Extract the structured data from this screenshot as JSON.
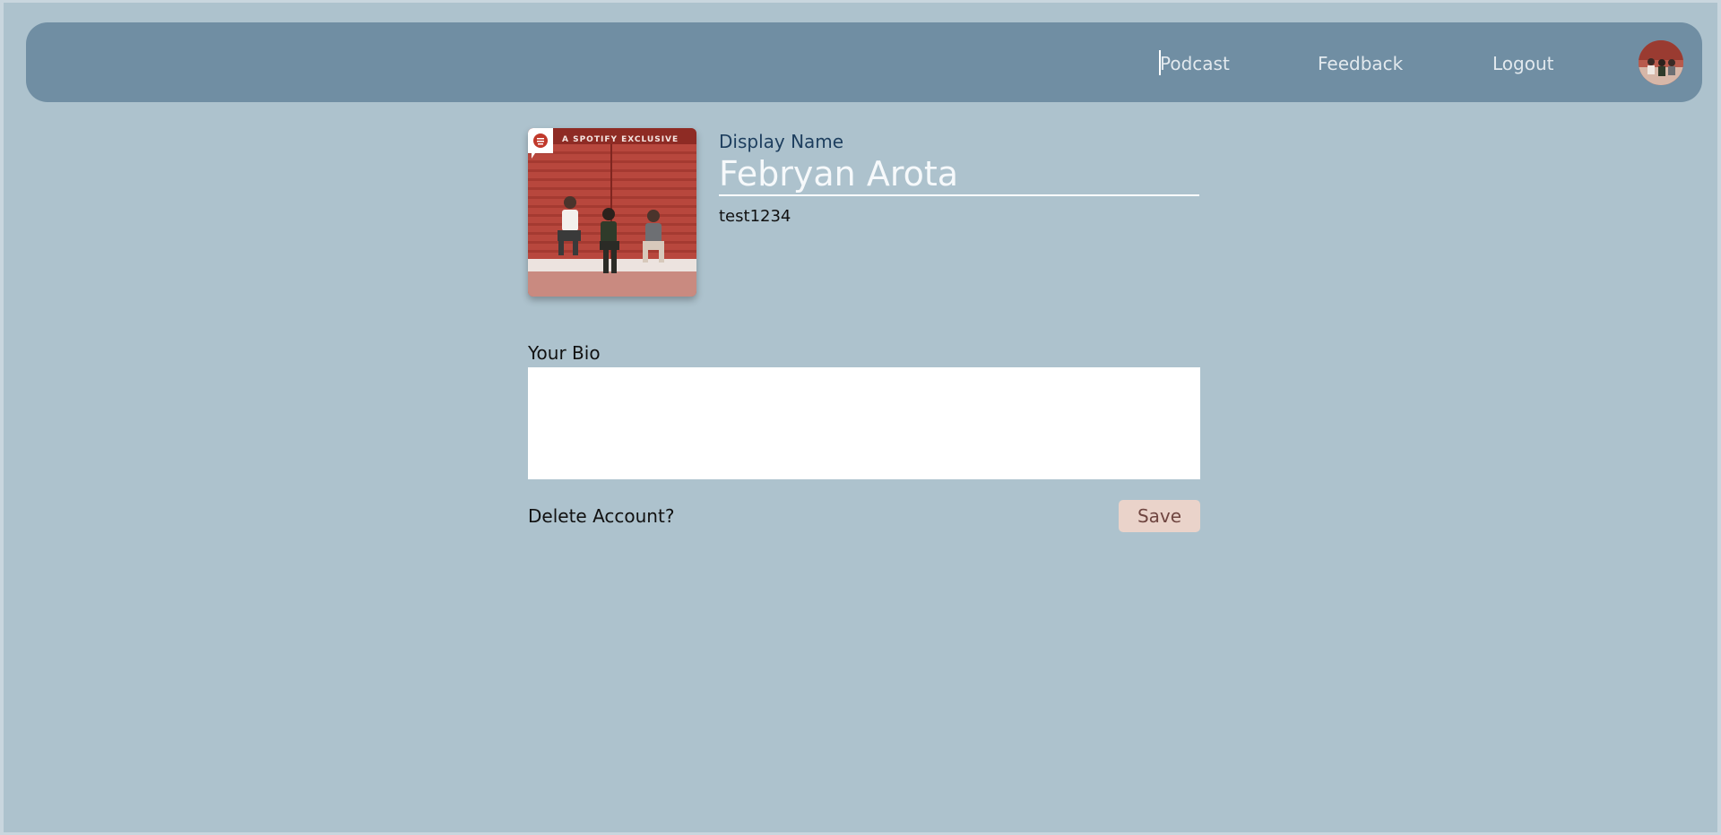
{
  "nav": {
    "links": [
      {
        "label": "Podcast"
      },
      {
        "label": "Feedback"
      },
      {
        "label": "Logout"
      }
    ],
    "avatar_icon": "user-avatar-photo"
  },
  "profile": {
    "cover_banner": "A SPOTIFY EXCLUSIVE",
    "cover_badge_icon": "spotify-logo-icon",
    "display_name_label": "Display Name",
    "display_name_value": "Febryan Arota",
    "username": "test1234"
  },
  "bio": {
    "label": "Your Bio",
    "value": ""
  },
  "actions": {
    "delete_label": "Delete Account?",
    "save_label": "Save"
  },
  "colors": {
    "page_background": "#adc2cd",
    "navbar": "#708ea3",
    "save_button": "#ead3ca",
    "save_text": "#6f4540",
    "display_label": "#1d3e5e"
  }
}
